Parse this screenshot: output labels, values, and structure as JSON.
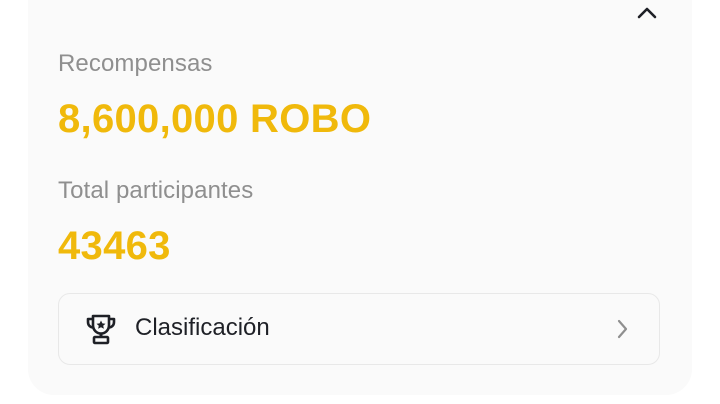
{
  "rewards": {
    "label": "Recompensas",
    "value": "8,600,000 ROBO"
  },
  "participants": {
    "label": "Total participantes",
    "value": "43463"
  },
  "ranking": {
    "label": "Clasificación"
  },
  "colors": {
    "accent": "#f0b90b",
    "label": "#8f8f8f",
    "text": "#1e2026",
    "card_bg": "#fafafa"
  },
  "icons": {
    "collapse": "chevron-up-icon",
    "ranking": "trophy-icon",
    "navigate": "chevron-right-icon"
  }
}
